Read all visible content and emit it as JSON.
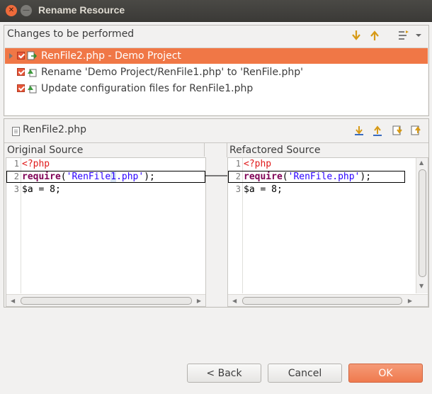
{
  "window": {
    "title": "Rename Resource"
  },
  "changes": {
    "title": "Changes to be performed",
    "items": [
      {
        "label": "RenFile2.php - Demo Project",
        "checked": true,
        "selected": true
      },
      {
        "label": "Rename 'Demo Project/RenFile1.php' to 'RenFile.php'",
        "checked": true,
        "selected": false
      },
      {
        "label": "Update configuration files for RenFile1.php",
        "checked": true,
        "selected": false
      }
    ]
  },
  "compare": {
    "file_label": "RenFile2.php",
    "original_title": "Original Source",
    "refactored_title": "Refactored Source",
    "original": {
      "line_numbers": [
        "1",
        "2",
        "3"
      ],
      "l1": "<?php",
      "l2_kw": "require",
      "l2_open": "(",
      "l2_str_a": "'RenFile",
      "l2_str_hl": "1",
      "l2_str_b": ".php'",
      "l2_close": ");",
      "l3": "$a = 8;"
    },
    "refactored": {
      "line_numbers": [
        "1",
        "2",
        "3"
      ],
      "l1": "<?php",
      "l2_kw": "require",
      "l2_open": "(",
      "l2_str": "'RenFile.php'",
      "l2_close": ");",
      "l3": "$a = 8;"
    }
  },
  "buttons": {
    "back": "< Back",
    "cancel": "Cancel",
    "ok": "OK"
  },
  "colors": {
    "accent": "#f07746",
    "titlebar": "#3e3d39"
  }
}
